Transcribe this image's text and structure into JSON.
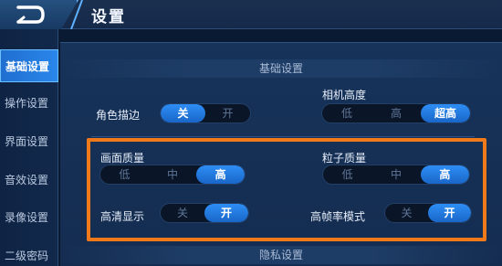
{
  "header": {
    "title": "设置",
    "back_icon": "back-arrow-icon"
  },
  "sidebar": {
    "items": [
      {
        "label": "基础设置",
        "active": true
      },
      {
        "label": "操作设置",
        "active": false
      },
      {
        "label": "界面设置",
        "active": false
      },
      {
        "label": "音效设置",
        "active": false
      },
      {
        "label": "录像设置",
        "active": false
      },
      {
        "label": "二级密码",
        "active": false
      }
    ]
  },
  "main": {
    "section_basic": "基础设置",
    "section_privacy": "隐私设置",
    "settings": {
      "character_outline": {
        "label": "角色描边",
        "options": [
          "关",
          "开"
        ],
        "selected": 0
      },
      "camera_height": {
        "label": "相机高度",
        "options": [
          "低",
          "高",
          "超高"
        ],
        "selected": 2
      },
      "image_quality": {
        "label": "画面质量",
        "options": [
          "低",
          "中",
          "高"
        ],
        "selected": 2
      },
      "particle_quality": {
        "label": "粒子质量",
        "options": [
          "低",
          "中",
          "高"
        ],
        "selected": 2
      },
      "hd_display": {
        "label": "高清显示",
        "options": [
          "关",
          "开"
        ],
        "selected": 1
      },
      "high_fps_mode": {
        "label": "高帧率模式",
        "options": [
          "关",
          "开"
        ],
        "selected": 1
      }
    }
  },
  "colors": {
    "accent": "#2a86ea",
    "highlight": "#f07a1a",
    "background": "#0b1a33"
  }
}
